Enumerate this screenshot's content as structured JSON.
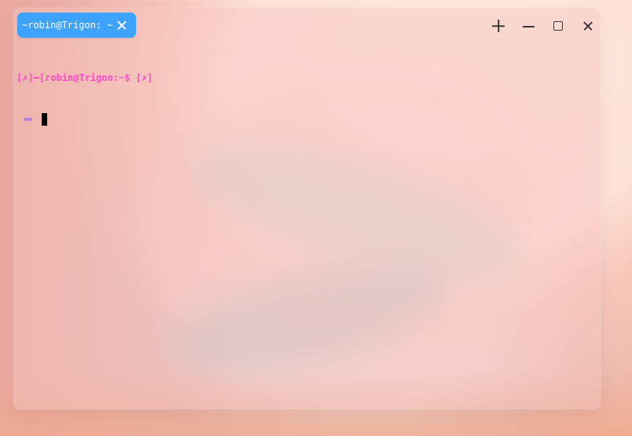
{
  "terminal": {
    "tab_title": "~robin@Trigon: ~",
    "prompt_status_left": "[✗]━",
    "prompt_user_host": "[robin@Trigon:~$",
    "prompt_status_right": " [✗]",
    "prompt_continuation": "»»"
  },
  "icons": {
    "tab_close": "close-icon",
    "new_tab": "plus-icon",
    "minimize": "minimize-icon",
    "maximize": "maximize-icon",
    "window_close": "close-icon"
  },
  "colors": {
    "tab_background": "#3ea2ff",
    "prompt_magenta": "#ff49c8",
    "prompt_purple": "#8552ff",
    "cursor": "#000000"
  }
}
